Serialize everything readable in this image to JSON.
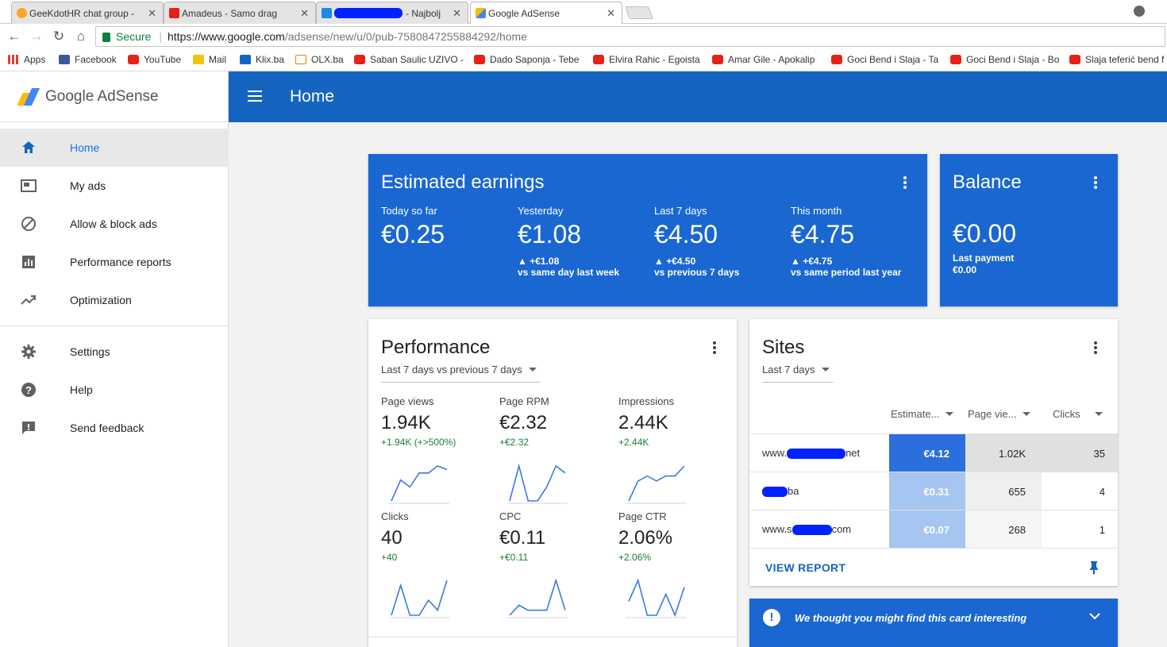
{
  "browser": {
    "tabs": [
      {
        "title": "GeeKdotHR chat group -",
        "favicon_color": "#f9a825"
      },
      {
        "title": "Amadeus - Samo drag",
        "favicon_color": "#e62117"
      },
      {
        "title": "- Najbolj",
        "favicon_color": "#1e88e5"
      },
      {
        "title": "Google AdSense",
        "favicon_color": "#fbbc04"
      }
    ],
    "url_secure_label": "Secure",
    "url_host": "https://www.google.com",
    "url_path": "/adsense/new/u/0/pub-7580847255884292/home",
    "bookmarks": [
      {
        "label": "Apps",
        "icon": "apps-grid-icon"
      },
      {
        "label": "Facebook",
        "icon": "facebook-icon"
      },
      {
        "label": "YouTube",
        "icon": "youtube-icon"
      },
      {
        "label": "Mail",
        "icon": "mail-icon"
      },
      {
        "label": "Klix.ba",
        "icon": "klix-icon"
      },
      {
        "label": "OLX.ba",
        "icon": "olx-icon"
      },
      {
        "label": "Saban Saulic UZIVO -",
        "icon": "youtube-icon"
      },
      {
        "label": "Dado Saponja - Tebe",
        "icon": "youtube-icon"
      },
      {
        "label": "Elvira Rahic - Egoista",
        "icon": "youtube-icon"
      },
      {
        "label": "Amar Gile - Apokalip",
        "icon": "youtube-icon"
      },
      {
        "label": "Goci Bend i Slaja - Ta",
        "icon": "youtube-icon"
      },
      {
        "label": "Goci Bend i Slaja - Bo",
        "icon": "youtube-icon"
      },
      {
        "label": "Slaja teferić bend f",
        "icon": "youtube-icon"
      }
    ]
  },
  "app": {
    "brand": "Google AdSense",
    "page_title": "Home",
    "accent": "#1565c0",
    "nav": [
      {
        "label": "Home",
        "icon": "home-icon",
        "active": true
      },
      {
        "label": "My ads",
        "icon": "ad-unit-icon"
      },
      {
        "label": "Allow & block ads",
        "icon": "block-icon"
      },
      {
        "label": "Performance reports",
        "icon": "bar-chart-icon"
      },
      {
        "label": "Optimization",
        "icon": "trending-up-icon"
      }
    ],
    "nav_secondary": [
      {
        "label": "Settings",
        "icon": "gear-icon"
      },
      {
        "label": "Help",
        "icon": "help-icon"
      },
      {
        "label": "Send feedback",
        "icon": "feedback-icon"
      }
    ]
  },
  "earnings": {
    "title": "Estimated earnings",
    "metrics": [
      {
        "label": "Today so far",
        "value": "€0.25",
        "delta": "",
        "comparison": ""
      },
      {
        "label": "Yesterday",
        "value": "€1.08",
        "delta": "▲ +€1.08",
        "comparison": "vs same day last week"
      },
      {
        "label": "Last 7 days",
        "value": "€4.50",
        "delta": "▲ +€4.50",
        "comparison": "vs previous 7 days"
      },
      {
        "label": "This month",
        "value": "€4.75",
        "delta": "▲ +€4.75",
        "comparison": "vs same period last year"
      }
    ]
  },
  "balance": {
    "title": "Balance",
    "value": "€0.00",
    "last_payment_label": "Last payment",
    "last_payment_value": "€0.00"
  },
  "performance": {
    "title": "Performance",
    "range": "Last 7 days vs previous 7 days",
    "metrics": [
      {
        "label": "Page views",
        "value": "1.94K",
        "delta": "+1.94K (+>500%)",
        "trend": [
          2,
          5,
          4,
          6,
          6,
          7,
          6.5
        ]
      },
      {
        "label": "Page RPM",
        "value": "€2.32",
        "delta": "+€2.32",
        "trend": [
          0,
          5,
          0,
          0,
          2,
          5,
          4
        ]
      },
      {
        "label": "Impressions",
        "value": "2.44K",
        "delta": "+2.44K",
        "trend": [
          0,
          4,
          5,
          4,
          5,
          5,
          7
        ]
      },
      {
        "label": "Clicks",
        "value": "40",
        "delta": "+40",
        "trend": [
          0,
          6,
          0,
          0,
          3,
          1,
          7
        ]
      },
      {
        "label": "CPC",
        "value": "€0.11",
        "delta": "+€0.11",
        "trend": [
          0,
          2,
          1,
          1,
          1,
          7,
          1
        ]
      },
      {
        "label": "Page CTR",
        "value": "2.06%",
        "delta": "+2.06%",
        "trend": [
          3,
          6,
          1,
          1,
          4,
          1,
          5
        ]
      }
    ]
  },
  "sites": {
    "title": "Sites",
    "range": "Last 7 days",
    "columns": [
      "Estimate...",
      "Page vie...",
      "Clicks"
    ],
    "rows": [
      {
        "prefix": "www.",
        "suffix": "net",
        "earnings": "€4.12",
        "page_views": "1.02K",
        "clicks": "35"
      },
      {
        "prefix": "",
        "suffix": "ba",
        "earnings": "€0.31",
        "page_views": "655",
        "clicks": "4"
      },
      {
        "prefix": "www.s",
        "suffix": "com",
        "earnings": "€0.07",
        "page_views": "268",
        "clicks": "1"
      }
    ],
    "view_report": "VIEW REPORT"
  },
  "tip": {
    "text": "We thought you might find this card interesting"
  }
}
